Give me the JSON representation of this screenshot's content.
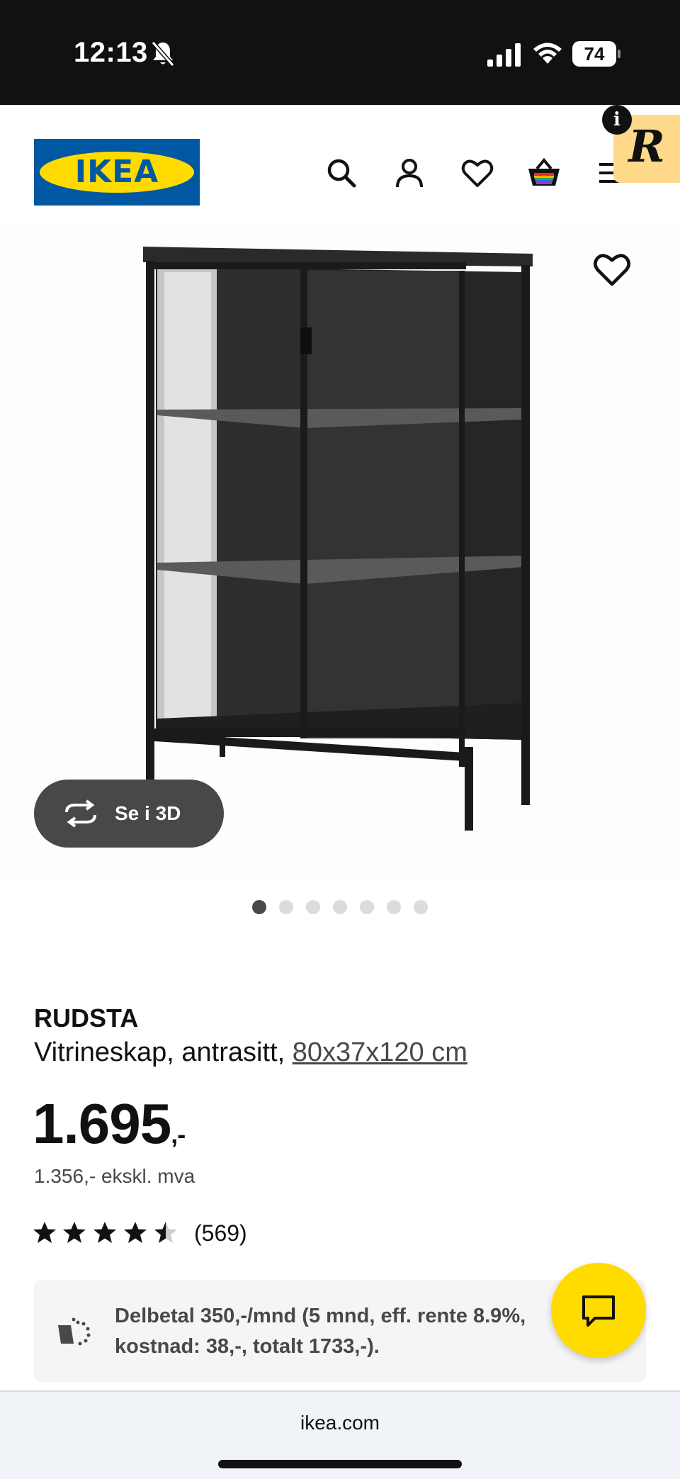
{
  "status_bar": {
    "time": "12:13",
    "battery": "74"
  },
  "header": {
    "logo_text": "IKEA",
    "icons": [
      "search-icon",
      "account-icon",
      "heart-icon",
      "basket-icon",
      "menu-icon"
    ],
    "extension_badge": "R",
    "info_badge": "i"
  },
  "gallery": {
    "see3d_label": "Se i 3D",
    "dots_total": 7,
    "active_dot": 0
  },
  "product": {
    "name": "RUDSTA",
    "description": "Vitrineskap, antrasitt,",
    "dimensions": "80x37x120 cm",
    "price": "1.695",
    "price_suffix": ",-",
    "price_ex_vat": "1.356,- ekskl. mva",
    "rating": 4.5,
    "rating_count": "(569)"
  },
  "financing": {
    "text": "Delbetal 350,-/mnd (5 mnd, eff. rente 8.9%, kostnad: 38,-, totalt 1733,-)."
  },
  "browser": {
    "url": "ikea.com"
  },
  "colors": {
    "ikea_blue": "#0058a3",
    "ikea_yellow": "#ffdb00",
    "cabinet": "#1e1e1e"
  }
}
